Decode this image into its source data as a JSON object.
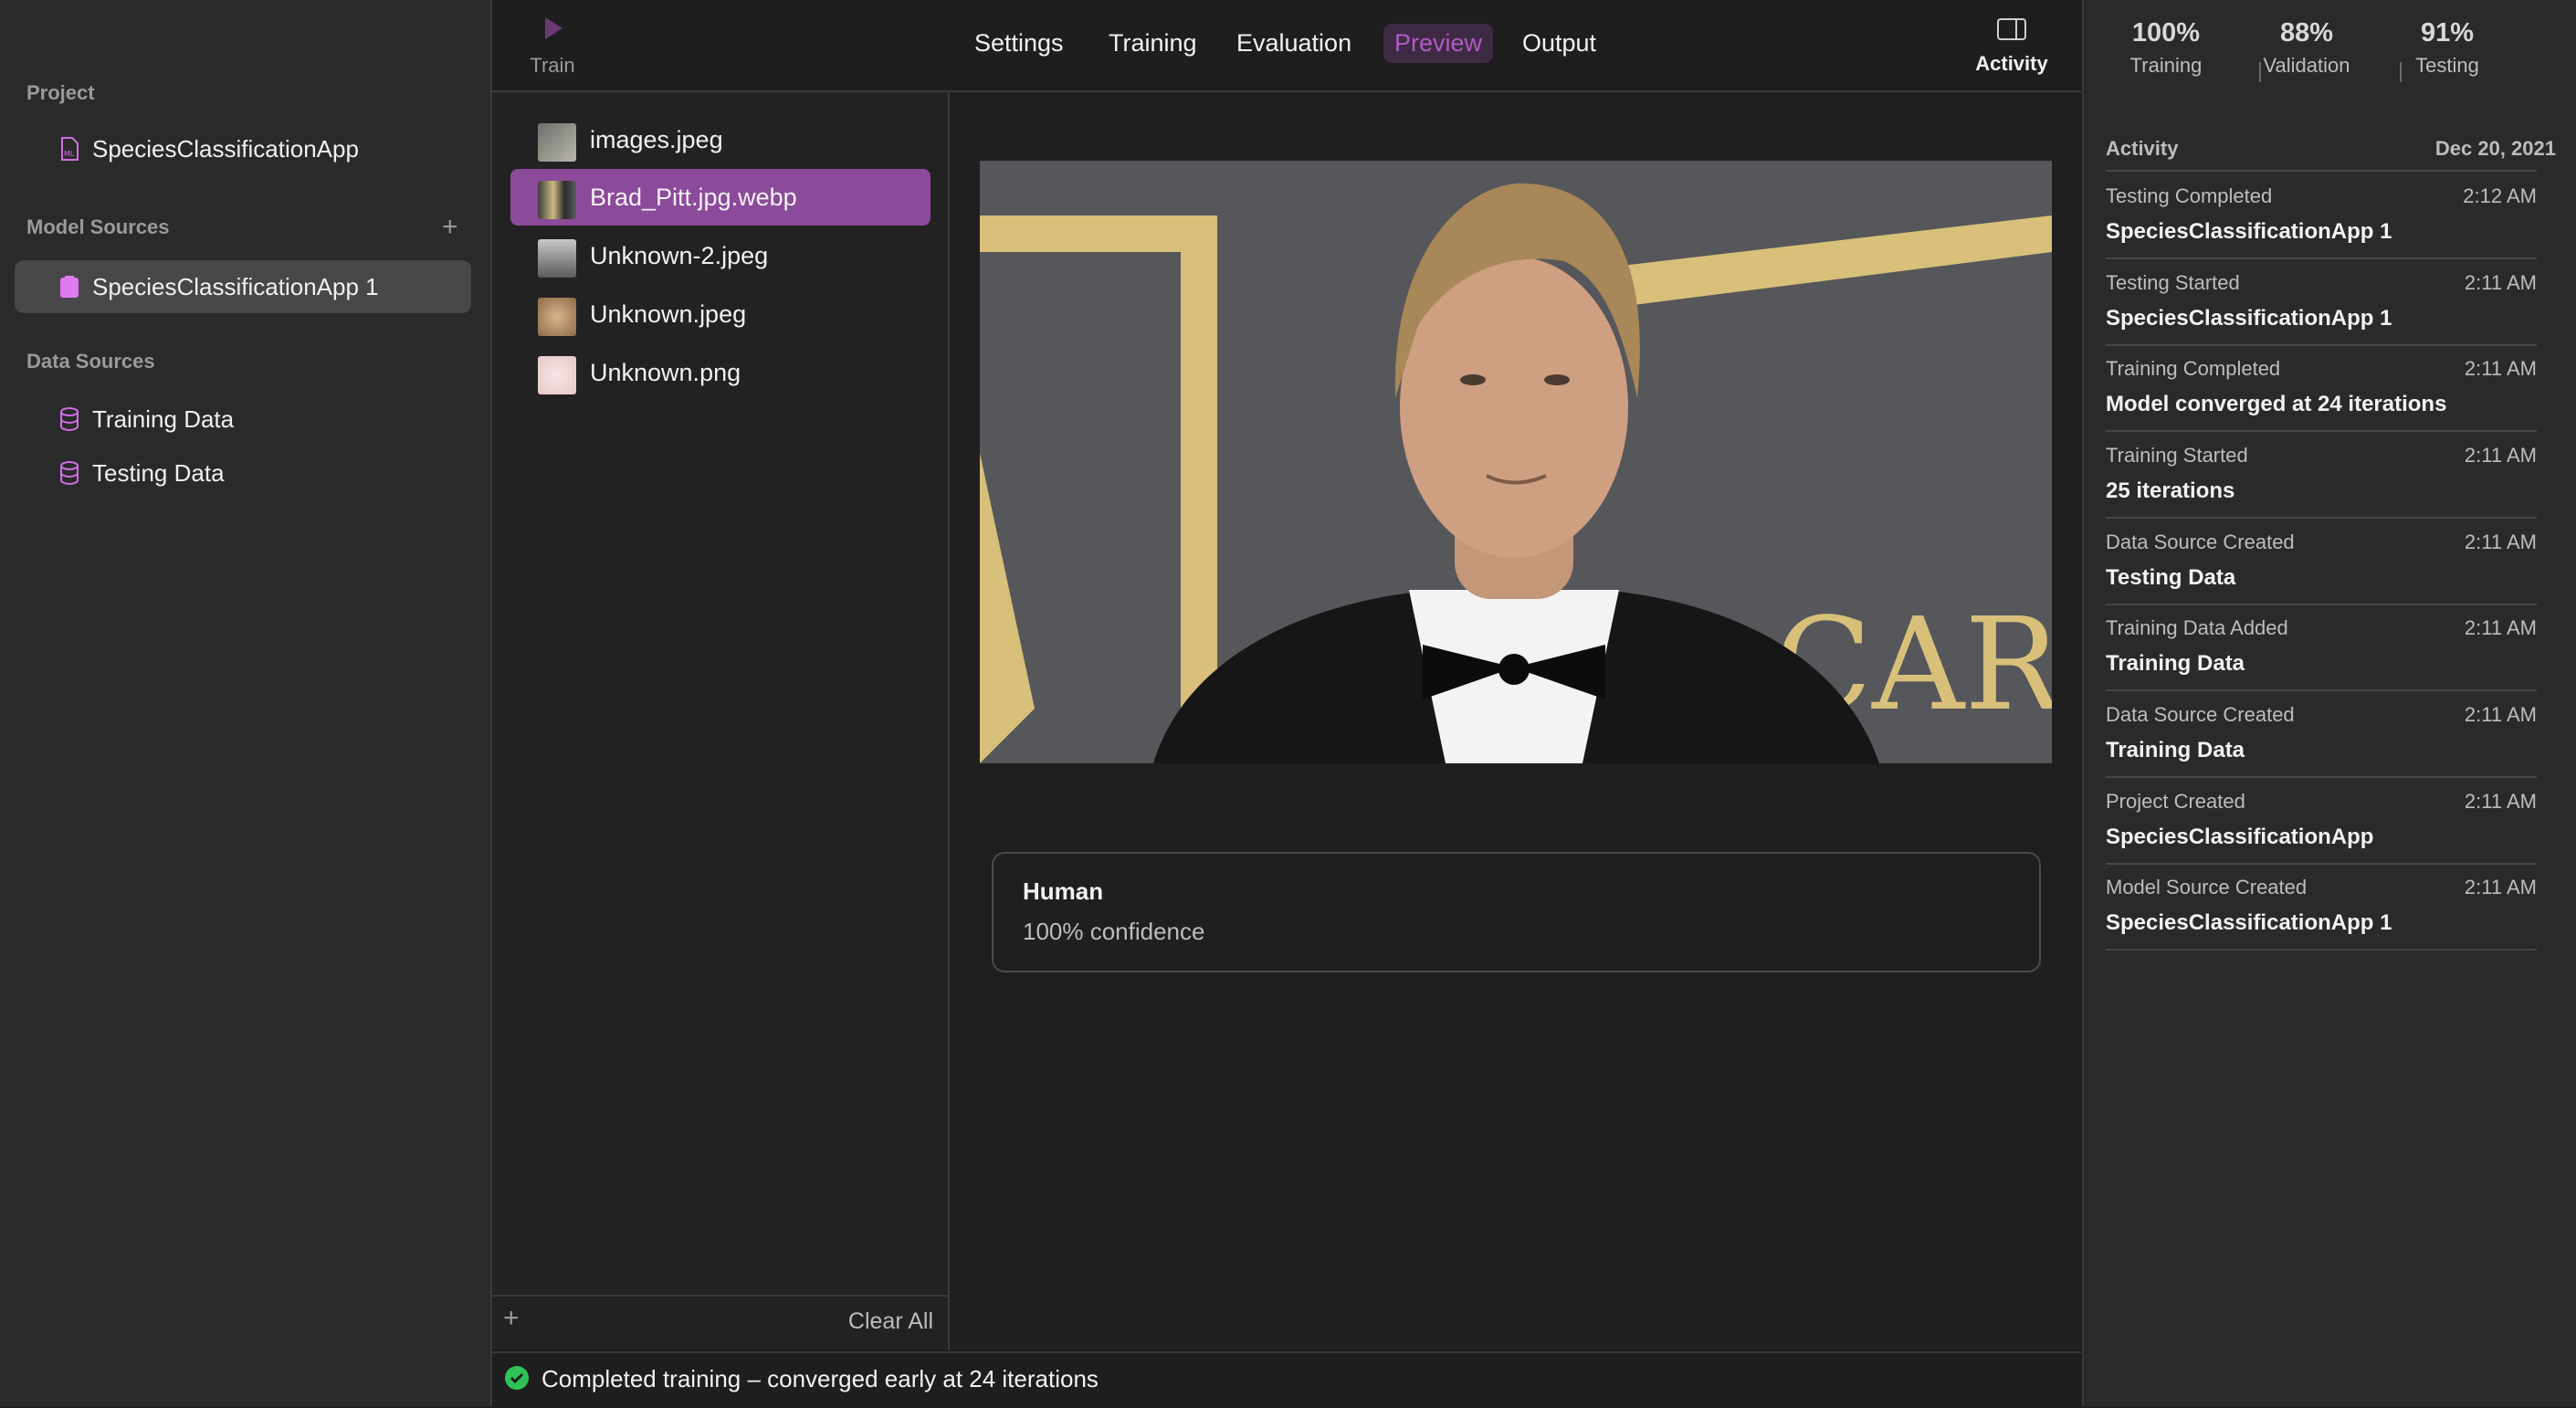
{
  "window": {
    "traffic_colors": [
      "#ed6a5e",
      "#f5bf4f",
      "#61c554"
    ]
  },
  "sidebar": {
    "project_title": "Project",
    "project_item": "SpeciesClassificationApp",
    "model_sources_title": "Model Sources",
    "model_source_item": "SpeciesClassificationApp 1",
    "data_sources_title": "Data Sources",
    "data_items": [
      "Training Data",
      "Testing Data"
    ],
    "accent": "#d36ee6"
  },
  "toolbar": {
    "train_label": "Train",
    "tabs": [
      "Settings",
      "Training",
      "Evaluation",
      "Preview",
      "Output"
    ],
    "active_tab": "Preview",
    "activity_label": "Activity"
  },
  "files": {
    "items": [
      "images.jpeg",
      "Brad_Pitt.jpg.webp",
      "Unknown-2.jpeg",
      "Unknown.jpeg",
      "Unknown.png"
    ],
    "selected": "Brad_Pitt.jpg.webp",
    "clear_label": "Clear All"
  },
  "prediction": {
    "label": "Human",
    "confidence": "100% confidence"
  },
  "metrics": [
    {
      "value": "100%",
      "label": "Training"
    },
    {
      "value": "88%",
      "label": "Validation"
    },
    {
      "value": "91%",
      "label": "Testing"
    }
  ],
  "activity": {
    "title": "Activity",
    "date": "Dec 20, 2021",
    "entries": [
      {
        "title": "Testing Completed",
        "time": "2:12 AM",
        "detail": "SpeciesClassificationApp 1"
      },
      {
        "title": "Testing Started",
        "time": "2:11 AM",
        "detail": "SpeciesClassificationApp 1"
      },
      {
        "title": "Training Completed",
        "time": "2:11 AM",
        "detail": "Model converged at 24 iterations"
      },
      {
        "title": "Training Started",
        "time": "2:11 AM",
        "detail": "25 iterations"
      },
      {
        "title": "Data Source Created",
        "time": "2:11 AM",
        "detail": "Testing Data"
      },
      {
        "title": "Training Data Added",
        "time": "2:11 AM",
        "detail": "Training Data"
      },
      {
        "title": "Data Source Created",
        "time": "2:11 AM",
        "detail": "Training Data"
      },
      {
        "title": "Project Created",
        "time": "2:11 AM",
        "detail": "SpeciesClassificationApp"
      },
      {
        "title": "Model Source Created",
        "time": "2:11 AM",
        "detail": "SpeciesClassificationApp 1"
      }
    ]
  },
  "status": {
    "text": "Completed training – converged early at 24 iterations",
    "color": "#30c257"
  }
}
